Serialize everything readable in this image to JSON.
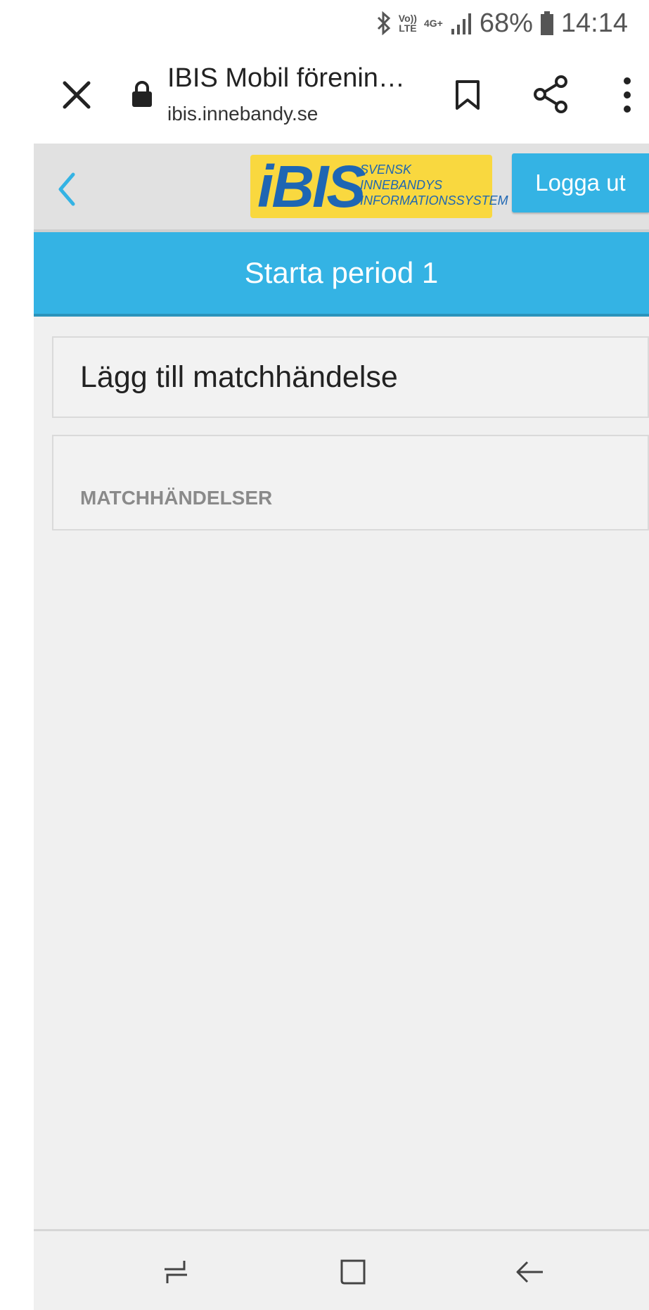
{
  "status_bar": {
    "volte": "Vo))",
    "volte_sub": "LTE",
    "network": "4G+",
    "battery": "68%",
    "time": "14:14"
  },
  "browser": {
    "title": "IBIS Mobil förenin…",
    "url": "ibis.innebandy.se"
  },
  "header": {
    "logo_text": "iBIS",
    "logo_tagline": [
      "SVENSK",
      "INNEBANDYS",
      "INFORMATIONSSYSTEM"
    ],
    "logout_label": "Logga ut"
  },
  "main": {
    "period_button": "Starta period 1",
    "add_event_label": "Lägg till matchhändelse",
    "events_heading": "MATCHHÄNDELSER"
  },
  "colors": {
    "accent": "#34b3e4",
    "logo_yellow": "#f9d83f",
    "logo_blue": "#1e66b3",
    "page_bg": "#f0f0f0"
  },
  "icons": [
    "bluetooth-icon",
    "signal-icon",
    "battery-icon",
    "close-icon",
    "lock-icon",
    "bookmark-icon",
    "share-icon",
    "more-vert-icon",
    "chevron-left-icon",
    "recent-apps-icon",
    "home-icon",
    "back-arrow-icon"
  ]
}
